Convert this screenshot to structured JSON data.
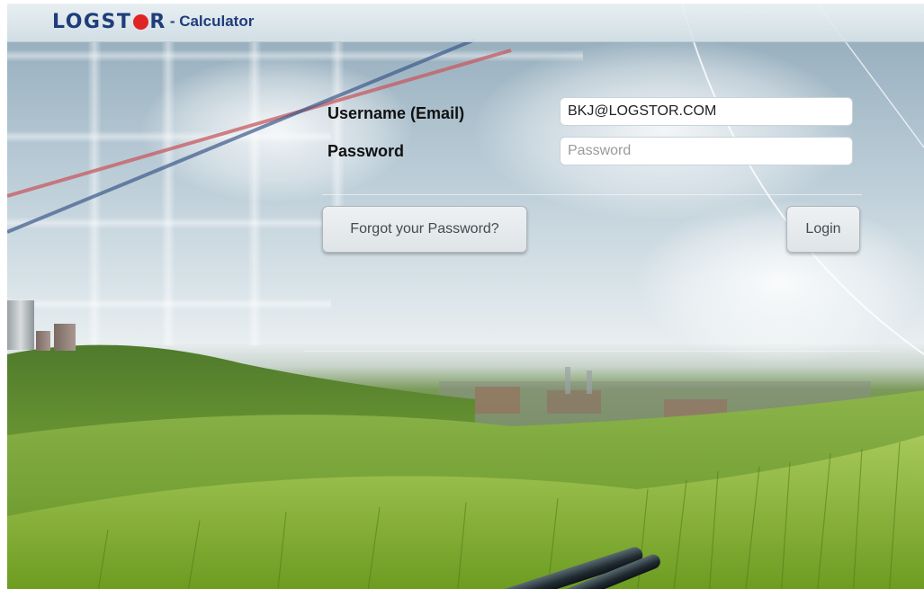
{
  "header": {
    "logo_left": "LOGST",
    "logo_right": "R",
    "subtitle": "- Calculator"
  },
  "form": {
    "username_label": "Username (Email)",
    "username_value": "BKJ@LOGSTOR.COM",
    "password_label": "Password",
    "password_placeholder": "Password",
    "forgot_label": "Forgot your Password?",
    "login_label": "Login"
  },
  "colors": {
    "brand_blue": "#1f3d7a",
    "brand_red": "#e02424"
  },
  "icons": {
    "logo_dot": "red-circle-o"
  }
}
